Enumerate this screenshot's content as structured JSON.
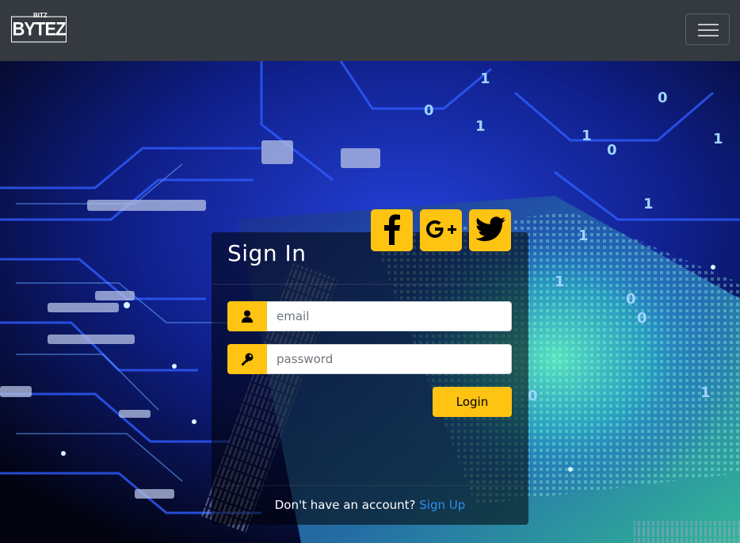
{
  "navbar": {
    "brand_small": "BITZ",
    "brand_big": "BYTEZ",
    "toggler_icon": "hamburger-menu-icon"
  },
  "login": {
    "title": "Sign In",
    "social": [
      {
        "name": "facebook",
        "icon": "facebook-icon"
      },
      {
        "name": "google-plus",
        "icon": "google-plus-icon"
      },
      {
        "name": "twitter",
        "icon": "twitter-icon"
      }
    ],
    "email_placeholder": "email",
    "email_value": "",
    "email_icon": "user-icon",
    "password_placeholder": "password",
    "password_value": "",
    "password_icon": "key-icon",
    "login_label": "Login",
    "footer_text": "Don't have an account?",
    "signup_label": "Sign Up"
  },
  "colors": {
    "navbar_bg": "#343a40",
    "accent": "#ffc312",
    "link": "#2f8cf1"
  }
}
